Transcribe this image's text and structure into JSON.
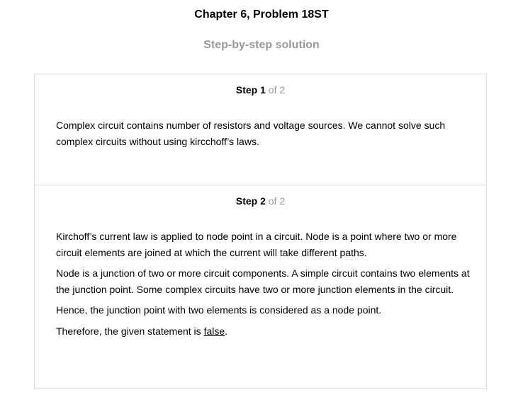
{
  "header": {
    "title": "Chapter 6, Problem 18ST",
    "subtitle": "Step-by-step solution"
  },
  "steps": [
    {
      "word": "Step",
      "number": "1",
      "of_text": "of 2",
      "paragraphs": [
        "Complex circuit contains number of resistors and voltage sources. We cannot solve such complex circuits without using kircchoff’s laws."
      ]
    },
    {
      "word": "Step",
      "number": "2",
      "of_text": "of 2",
      "paragraphs": [
        "Kirchoff’s current law is applied to node point in a circuit. Node is a point where two or more circuit elements are joined at which the current will take different paths.",
        "Node is a junction of two or more circuit components. A simple circuit contains two elements at the junction point. Some complex circuits have two or more junction elements in the circuit.",
        "Hence, the junction point with two elements is considered as a node point."
      ],
      "final_prefix": "Therefore, the given statement is ",
      "final_answer": "false",
      "final_suffix": "."
    }
  ],
  "colors": {
    "subtitle": "#999999",
    "border": "#dcdcdc"
  }
}
